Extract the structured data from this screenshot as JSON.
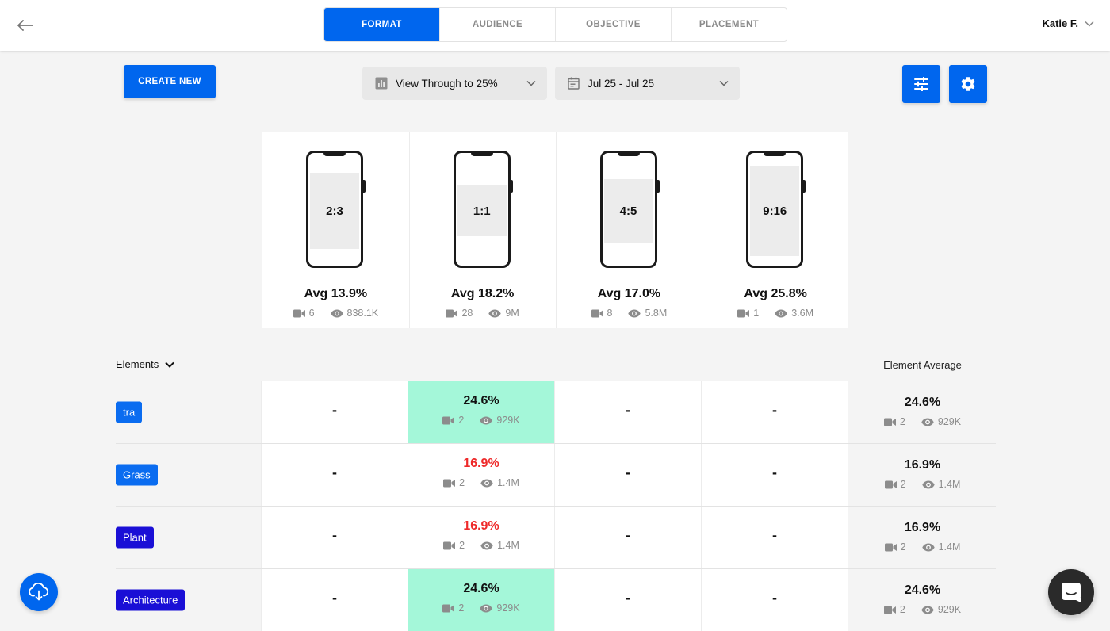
{
  "header": {
    "tabs": [
      {
        "label": "FORMAT",
        "active": true
      },
      {
        "label": "AUDIENCE",
        "active": false
      },
      {
        "label": "OBJECTIVE",
        "active": false
      },
      {
        "label": "PLACEMENT",
        "active": false
      }
    ],
    "user_name": "Katie F."
  },
  "toolbar": {
    "create_label": "CREATE NEW",
    "metric_label": "View Through to 25%",
    "date_label": "Jul 25 - Jul 25"
  },
  "formats": [
    {
      "ratio": "2:3",
      "avg": "Avg 13.9%",
      "videos": "6",
      "views": "838.1K"
    },
    {
      "ratio": "1:1",
      "avg": "Avg 18.2%",
      "videos": "28",
      "views": "9M"
    },
    {
      "ratio": "4:5",
      "avg": "Avg 17.0%",
      "videos": "8",
      "views": "5.8M"
    },
    {
      "ratio": "9:16",
      "avg": "Avg 25.8%",
      "videos": "1",
      "views": "3.6M"
    }
  ],
  "table": {
    "elements_label": "Elements",
    "avg_header": "Element Average",
    "dash": "-",
    "rows": [
      {
        "tag": "tra",
        "tag_color": "#0a6cf0",
        "value": "24.6%",
        "value_color": "#111111",
        "highlight": true,
        "videos": "2",
        "views": "929K",
        "avg": "24.6%",
        "avg_videos": "2",
        "avg_views": "929K"
      },
      {
        "tag": "Grass",
        "tag_color": "#0a6cf0",
        "value": "16.9%",
        "value_color": "#ee2a2a",
        "highlight": false,
        "videos": "2",
        "views": "1.4M",
        "avg": "16.9%",
        "avg_videos": "2",
        "avg_views": "1.4M"
      },
      {
        "tag": "Plant",
        "tag_color": "#1a0fd6",
        "value": "16.9%",
        "value_color": "#ee2a2a",
        "highlight": false,
        "videos": "2",
        "views": "1.4M",
        "avg": "16.9%",
        "avg_videos": "2",
        "avg_views": "1.4M"
      },
      {
        "tag": "Architecture",
        "tag_color": "#1a0fd6",
        "value": "24.6%",
        "value_color": "#111111",
        "highlight": true,
        "videos": "2",
        "views": "929K",
        "avg": "24.6%",
        "avg_videos": "2",
        "avg_views": "929K"
      }
    ]
  },
  "colors": {
    "accent": "#0066ee",
    "highlight": "#a4f7d9",
    "negative": "#ee2a2a"
  },
  "icons": {
    "back": "arrow-left-icon",
    "filter": "sliders-icon",
    "settings": "gear-icon",
    "download": "cloud-download-icon",
    "chat": "chat-icon",
    "video": "video-camera-icon",
    "views": "eye-icon"
  }
}
